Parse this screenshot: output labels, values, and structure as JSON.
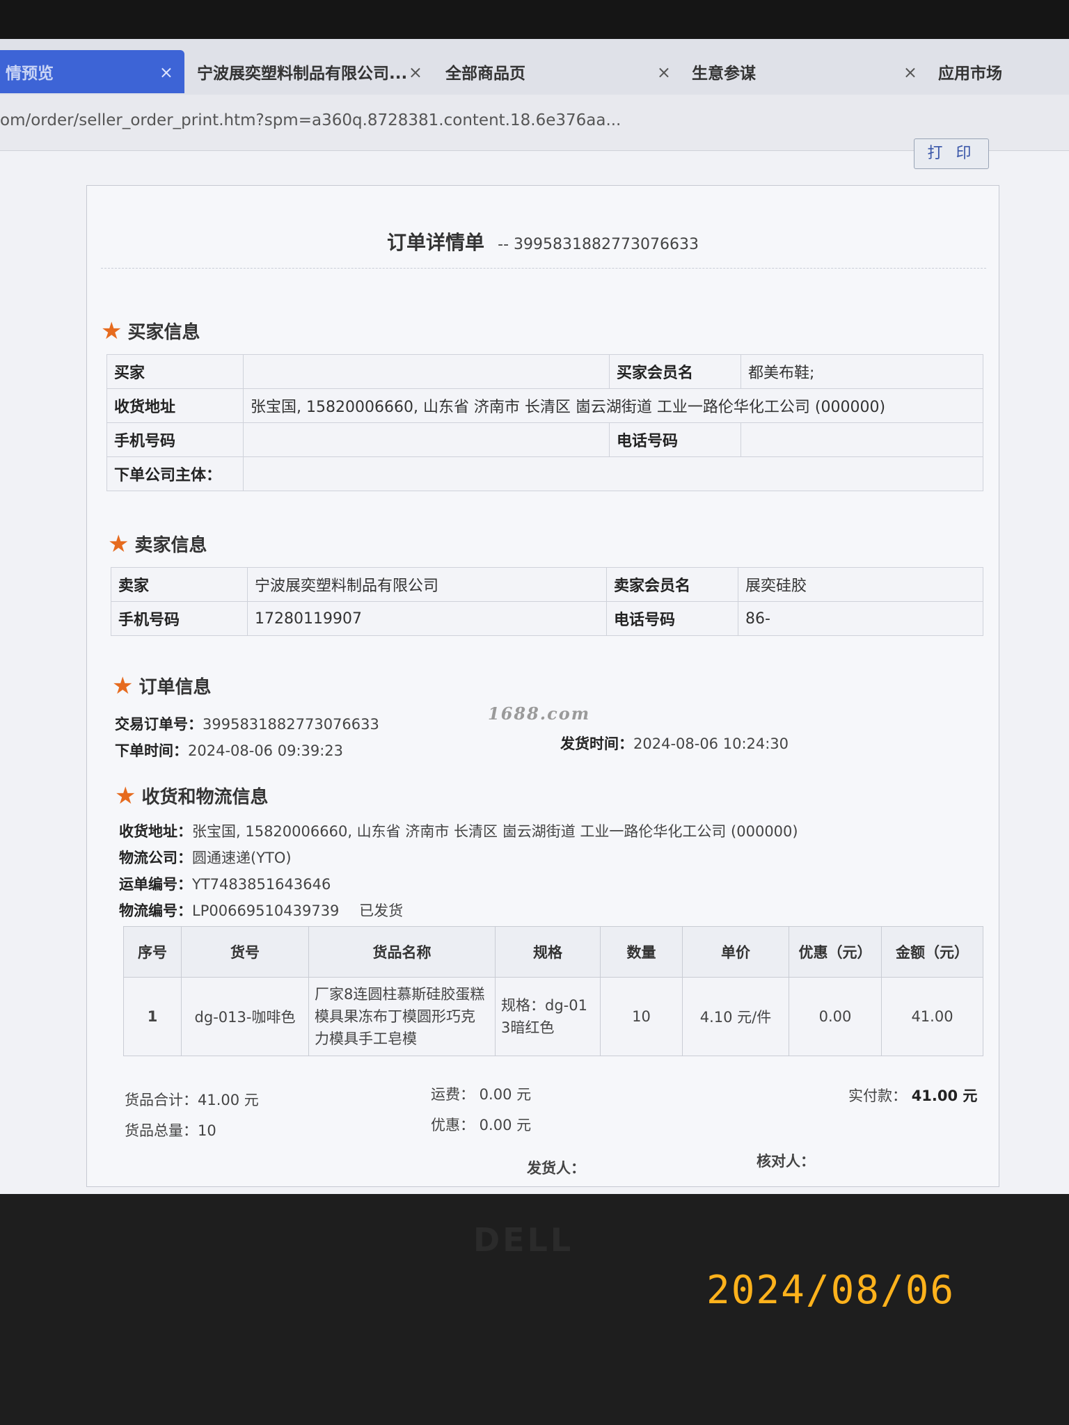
{
  "tabs": [
    {
      "label": "情预览",
      "active": true
    },
    {
      "label": "宁波展奕塑料制品有限公司...",
      "active": false
    },
    {
      "label": "全部商品页",
      "active": false
    },
    {
      "label": "生意参谋",
      "active": false
    },
    {
      "label": "应用市场",
      "active": false
    }
  ],
  "tab_close": "×",
  "url": "om/order/seller_order_print.htm?spm=a360q.8728381.content.18.6e376aa...",
  "print_button": "打 印",
  "sheet": {
    "title": "订单详情单",
    "order_no": "-- 3995831882773076633"
  },
  "buyer": {
    "heading": "买家信息",
    "buyer_label": "买家",
    "buyer_value": "",
    "member_label": "买家会员名",
    "member_value": "都美布鞋;",
    "address_label": "收货地址",
    "address_value": "张宝国, 15820006660, 山东省 济南市 长清区 崮云湖街道 工业一路伦华化工公司 (000000)",
    "mobile_label": "手机号码",
    "mobile_value": "",
    "phone_label": "电话号码",
    "phone_value": "",
    "company_label": "下单公司主体：",
    "company_value": ""
  },
  "seller": {
    "heading": "卖家信息",
    "seller_label": "卖家",
    "seller_value": "宁波展奕塑料制品有限公司",
    "member_label": "卖家会员名",
    "member_value": "展奕硅胶",
    "mobile_label": "手机号码",
    "mobile_value": "17280119907",
    "phone_label": "电话号码",
    "phone_value": "86-"
  },
  "order": {
    "heading": "订单信息",
    "trade_no_label": "交易订单号：",
    "trade_no": "3995831882773076633",
    "order_time_label": "下单时间：",
    "order_time": "2024-08-06 09:39:23",
    "ship_time_label": "发货时间：",
    "ship_time": "2024-08-06 10:24:30",
    "watermark": "1688.com"
  },
  "logistics": {
    "heading": "收货和物流信息",
    "address_label": "收货地址：",
    "address": "张宝国, 15820006660, 山东省 济南市 长清区 崮云湖街道 工业一路伦华化工公司 (000000)",
    "company_label": "物流公司：",
    "company": "圆通速递(YTO)",
    "waybill_label": "运单编号：",
    "waybill": "YT7483851643646",
    "logistics_no_label": "物流编号：",
    "logistics_no": "LP00669510439739",
    "status": "已发货"
  },
  "items_table": {
    "headers": [
      "序号",
      "货号",
      "货品名称",
      "规格",
      "数量",
      "单价",
      "优惠（元）",
      "金额（元）"
    ],
    "rows": [
      {
        "seq": "1",
        "sku": "dg-013-咖啡色",
        "name": "厂家8连圆柱慕斯硅胶蛋糕模具果冻布丁模圆形巧克力模具手工皂模",
        "spec": "规格：dg-013暗红色",
        "qty": "10",
        "price": "4.10 元/件",
        "discount": "0.00",
        "amount": "41.00"
      }
    ]
  },
  "totals": {
    "goods_total": "货品合计：41.00 元",
    "goods_count": "货品总量：10",
    "freight": "运费： 0.00 元",
    "discount": "优惠： 0.00 元",
    "paid_label": "实付款：",
    "paid_value": "41.00 元",
    "shipper_label": "发货人：",
    "checker_label": "核对人："
  },
  "hardware": {
    "brand": "DELL",
    "date_stamp": "2024/08/06"
  },
  "colors": {
    "active_tab": "#3d64d6",
    "star": "#e66b1f",
    "date_stamp": "#ffb21c"
  }
}
